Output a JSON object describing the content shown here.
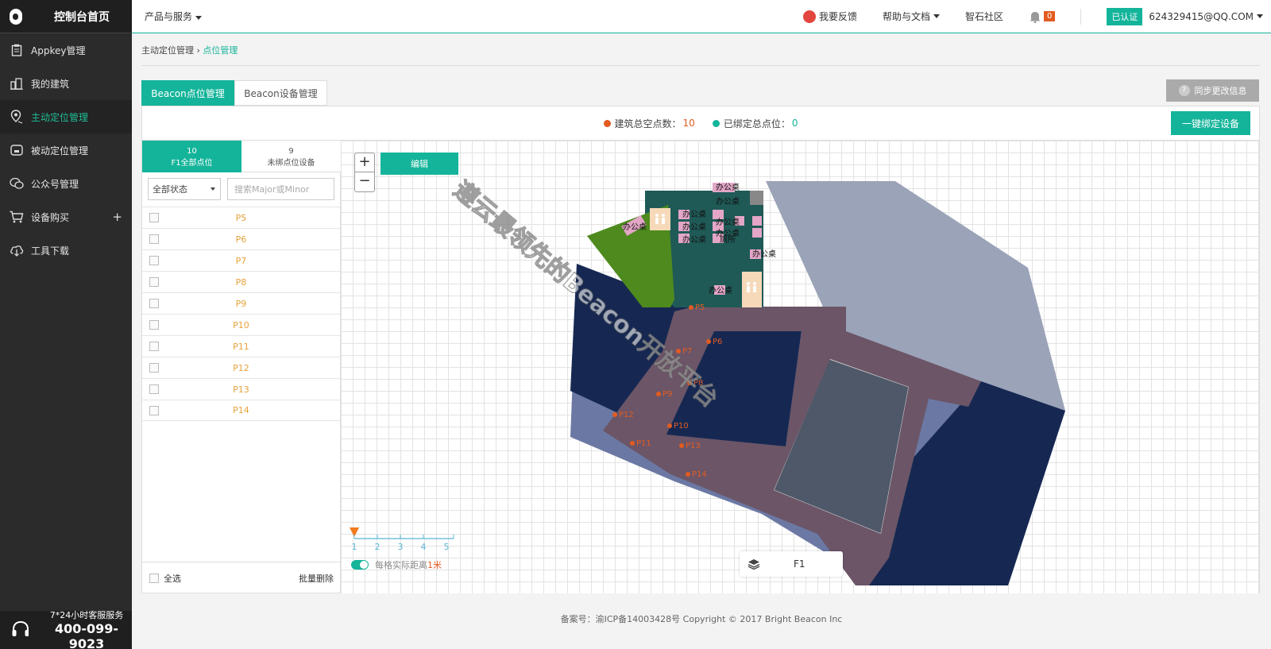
{
  "sidebar": {
    "title": "控制台首页",
    "items": [
      {
        "label": "Appkey管理",
        "icon": "clipboard-icon"
      },
      {
        "label": "我的建筑",
        "icon": "building-icon"
      },
      {
        "label": "主动定位管理",
        "icon": "location-pin-icon",
        "active": true
      },
      {
        "label": "被动定位管理",
        "icon": "device-icon"
      },
      {
        "label": "公众号管理",
        "icon": "wechat-icon"
      },
      {
        "label": "设备购买",
        "icon": "cart-icon"
      },
      {
        "label": "工具下载",
        "icon": "cloud-download-icon"
      }
    ],
    "service_label": "7*24小时客服服务",
    "service_phone": "400-099-9023"
  },
  "topbar": {
    "products": "产品与服务",
    "feedback": "我要反馈",
    "help": "帮助与文档",
    "community": "智石社区",
    "notifications": "0",
    "certified": "已认证",
    "account": "624329415@QQ.COM"
  },
  "breadcrumb": {
    "parent": "主动定位管理",
    "separator": "›",
    "current": "点位管理"
  },
  "tabs": [
    {
      "label": "Beacon点位管理",
      "active": true
    },
    {
      "label": "Beacon设备管理",
      "active": false
    }
  ],
  "sync_button": "同步更改信息",
  "stats": {
    "total_label": "建筑总空点数：",
    "total_value": "10",
    "bound_label": "已绑定总点位：",
    "bound_value": "0",
    "total_color": "#e25b20",
    "bound_color": "#14b49a"
  },
  "bind_button": "一键绑定设备",
  "left_tabs": [
    {
      "count": "10",
      "label": "F1全部点位"
    },
    {
      "count": "9",
      "label": "未绑点位设备"
    }
  ],
  "filter": {
    "value": "全部状态"
  },
  "search": {
    "placeholder": "搜索Major或Minor"
  },
  "points": [
    "P5",
    "P6",
    "P7",
    "P8",
    "P9",
    "P10",
    "P11",
    "P12",
    "P13",
    "P14"
  ],
  "list_footer": {
    "select_all": "全选",
    "batch_delete": "批量删除"
  },
  "map": {
    "zoom_in": "+",
    "zoom_out": "−",
    "edit_button": "编辑",
    "scale_ticks": [
      "1",
      "2",
      "3",
      "4",
      "5"
    ],
    "grid_text": "每格实际距离",
    "grid_value": "1米",
    "floor": "F1",
    "room_labels": [
      "办公桌",
      "办公桌",
      "办公桌",
      "办公桌",
      "办公桌",
      "办公桌",
      "办公桌",
      "办公桌",
      "厕所",
      "办公桌",
      "办公桌"
    ],
    "beacons": [
      {
        "label": "P5"
      },
      {
        "label": "P6"
      },
      {
        "label": "P7"
      },
      {
        "label": "P8"
      },
      {
        "label": "P9"
      },
      {
        "label": "P10"
      },
      {
        "label": "P11"
      },
      {
        "label": "P12"
      },
      {
        "label": "P13"
      },
      {
        "label": "P14"
      }
    ],
    "watermark": "遵云最领先的Beacon开放平台"
  },
  "footer": "备案号：渝ICP备14003428号 Copyright © 2017 Bright Beacon Inc"
}
